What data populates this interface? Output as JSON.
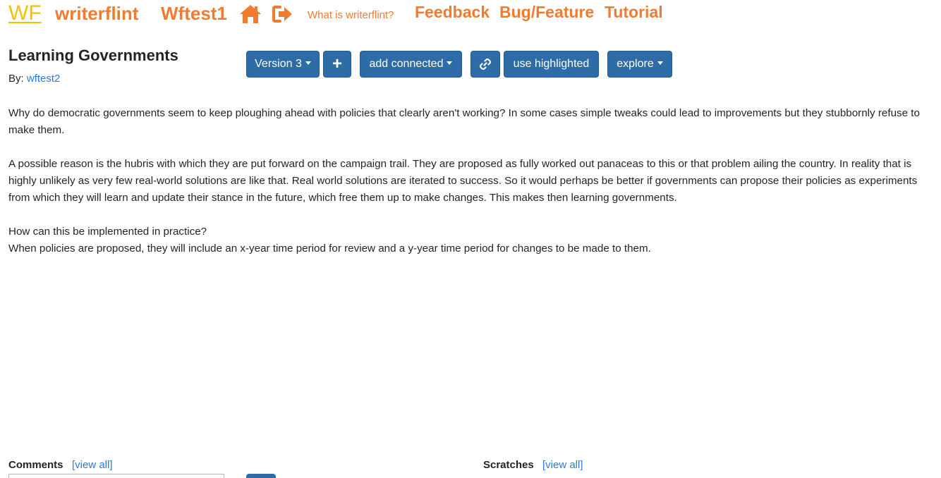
{
  "navbar": {
    "logo": "WF",
    "brand": "writerflint",
    "user": "Wftest1",
    "home_icon": "home-icon",
    "signout_icon": "sign-out-icon",
    "what_is": "What is writerflint?",
    "feedback": "Feedback",
    "bug_feature": "Bug/Feature",
    "tutorial": "Tutorial",
    "accent_color": "#f07c32",
    "logo_color": "#f2c200"
  },
  "document": {
    "title": "Learning Governments",
    "by_label": "By:",
    "author": "wftest2",
    "paragraphs": [
      "Why do democratic governments seem to keep ploughing ahead with policies that clearly aren't working? In some cases simple tweaks could lead to improvements but they stubbornly refuse to make them.",
      "A possible reason is the hubris with which they are put forward on the campaign trail. They are proposed as fully worked out panaceas to this or that problem ailing the country. In reality that is highly unlikely as very few real-world solutions are like that. Real world solutions are iterated to success. So it would perhaps be better if governments can propose their policies as experiments from which they will learn and update their stance in the future, which free them up to make changes. This makes then learning governments.",
      "How can this be implemented in practice?",
      "When policies are proposed, they will include an x-year time period for review and a y-year time period for changes to be made to them."
    ]
  },
  "toolbar": {
    "version": "Version 3",
    "plus": "+",
    "add_connected": "add connected",
    "link_icon": "link-icon",
    "use_highlighted": "use highlighted",
    "explore": "explore",
    "button_color": "#2e6ca8"
  },
  "comments": {
    "label": "Comments",
    "view_all": "[view all]"
  },
  "scratches": {
    "label": "Scratches",
    "view_all": "[view all]"
  }
}
